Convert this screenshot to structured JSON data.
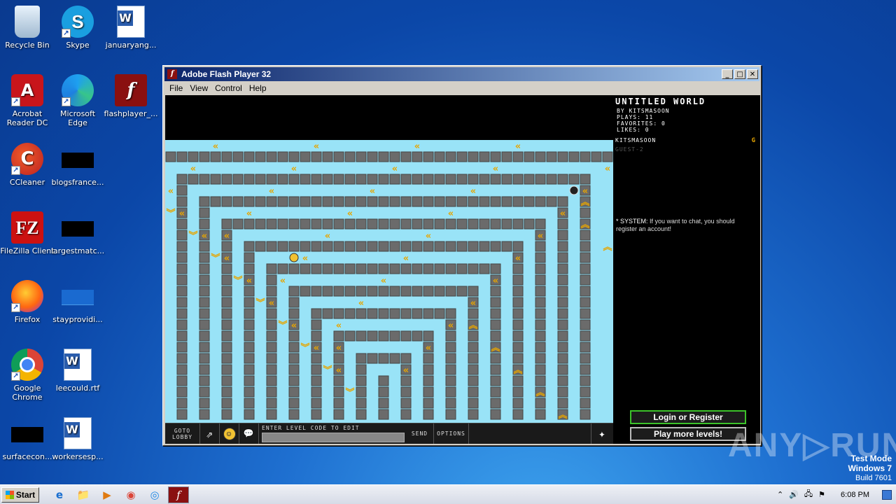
{
  "desktop": {
    "icons": [
      {
        "label": "Recycle Bin",
        "glyph": ""
      },
      {
        "label": "Skype",
        "glyph": "S"
      },
      {
        "label": "januaryang...",
        "glyph": ""
      },
      {
        "label": "Acrobat Reader DC",
        "glyph": "A"
      },
      {
        "label": "Microsoft Edge",
        "glyph": ""
      },
      {
        "label": "flashplayer_...",
        "glyph": "f"
      },
      {
        "label": "CCleaner",
        "glyph": "C"
      },
      {
        "label": "blogsfrance...",
        "glyph": ""
      },
      {
        "label": "FileZilla Client",
        "glyph": "FZ"
      },
      {
        "label": "largestmatc...",
        "glyph": ""
      },
      {
        "label": "Firefox",
        "glyph": ""
      },
      {
        "label": "stayprovidi...",
        "glyph": ""
      },
      {
        "label": "Google Chrome",
        "glyph": ""
      },
      {
        "label": "leecould.rtf",
        "glyph": ""
      },
      {
        "label": "surfacecon...",
        "glyph": ""
      },
      {
        "label": "workersesp...",
        "glyph": ""
      }
    ]
  },
  "window": {
    "title": "Adobe Flash Player 32",
    "menu": [
      "File",
      "View",
      "Control",
      "Help"
    ],
    "controls": {
      "minimize": "_",
      "maximize": "□",
      "close": "✕"
    }
  },
  "game": {
    "colors": {
      "floor": "#99e3f7",
      "wall": "#6b6b6b",
      "arrow": "#e7a500"
    },
    "toolbar": {
      "lobby": "GOTO LOBBY",
      "level_code_label": "ENTER LEVEL CODE TO EDIT",
      "send": "SEND",
      "options": "OPTIONS",
      "share_icon": "⇗",
      "smiley_icon": "☺",
      "chat_icon": "💬",
      "star_icon": "✦"
    }
  },
  "side_panel": {
    "world_title": "UNTITLED WORLD",
    "by": "BY KITSMASOON",
    "plays": "PLAYS: 11",
    "favorites": "FAVORITES: 0",
    "likes": "LIKES: 0",
    "players": [
      {
        "name": "KITSMASOON",
        "badge": "G"
      },
      {
        "name": "GUEST-2",
        "badge": ""
      }
    ],
    "chat": {
      "sender": "* SYSTEM:",
      "message": "If you want to chat, you should register an account!"
    },
    "login_button": "Login or Register",
    "more_button": "Play more levels!"
  },
  "taskbar": {
    "start": "Start",
    "clock": "6:08 PM",
    "apps": [
      "e",
      "📁",
      "▶",
      "◉",
      "◎",
      "f"
    ]
  },
  "watermark": "ANY▷RUN",
  "test_mode": {
    "line1": "Test Mode",
    "line2": "Windows 7",
    "line3": "Build 7601"
  }
}
